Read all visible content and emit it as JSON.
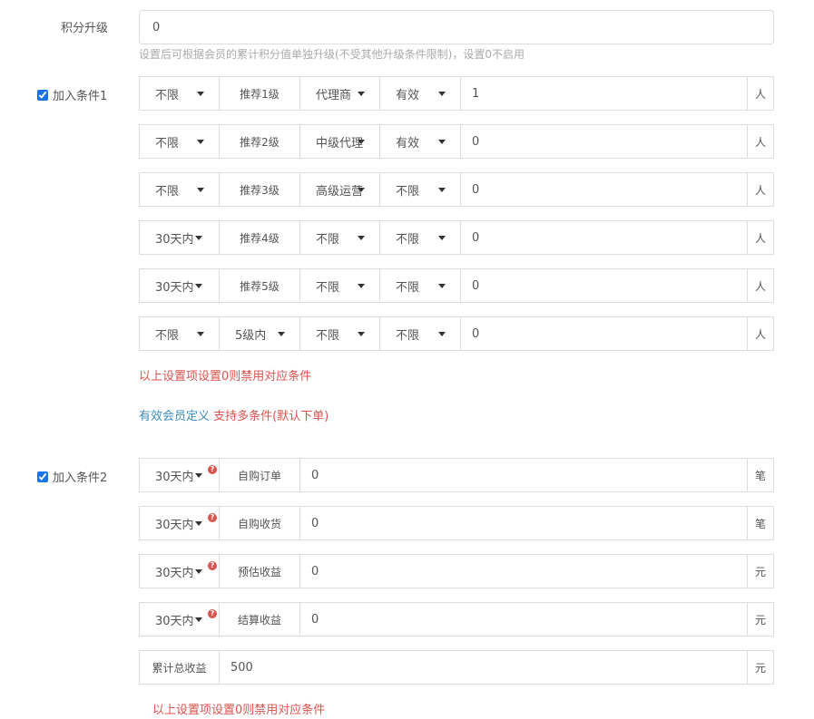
{
  "points": {
    "label": "积分升级",
    "value": "0",
    "hint": "设置后可根据会员的累计积分值单独升级(不受其他升级条件限制)，设置0不启用"
  },
  "cond1": {
    "label": "加入条件1",
    "checked": true,
    "rows": [
      {
        "period": "不限",
        "level": "推荐1级",
        "agent": "代理商",
        "status": "有效",
        "value": "1",
        "unit": "人"
      },
      {
        "period": "不限",
        "level": "推荐2级",
        "agent": "中级代理",
        "status": "有效",
        "value": "0",
        "unit": "人"
      },
      {
        "period": "不限",
        "level": "推荐3级",
        "agent": "高级运营",
        "status": "不限",
        "value": "0",
        "unit": "人"
      },
      {
        "period": "30天内",
        "level": "推荐4级",
        "agent": "不限",
        "status": "不限",
        "value": "0",
        "unit": "人"
      },
      {
        "period": "30天内",
        "level": "推荐5级",
        "agent": "不限",
        "status": "不限",
        "value": "0",
        "unit": "人"
      },
      {
        "period": "不限",
        "level": "5级内",
        "agent": "不限",
        "status": "不限",
        "value": "0",
        "unit": "人"
      }
    ],
    "note": "以上设置项设置0则禁用对应条件",
    "link": "有效会员定义",
    "extra": "支持多条件(默认下单)"
  },
  "cond2": {
    "label": "加入条件2",
    "checked": true,
    "rows": [
      {
        "period": "30天内",
        "name": "自购订单",
        "value": "0",
        "unit": "笔"
      },
      {
        "period": "30天内",
        "name": "自购收货",
        "value": "0",
        "unit": "笔"
      },
      {
        "period": "30天内",
        "name": "预估收益",
        "value": "0",
        "unit": "元"
      },
      {
        "period": "30天内",
        "name": "结算收益",
        "value": "0",
        "unit": "元"
      }
    ],
    "total": {
      "name": "累计总收益",
      "value": "500",
      "unit": "元"
    },
    "note": "以上设置项设置0则禁用对应条件"
  },
  "icons": {
    "help": "question-circle-icon",
    "caret": "caret-down-icon"
  },
  "colors": {
    "warning": "#d9534f",
    "link": "#3c8dbc",
    "checkbox": "#1a73e8"
  }
}
